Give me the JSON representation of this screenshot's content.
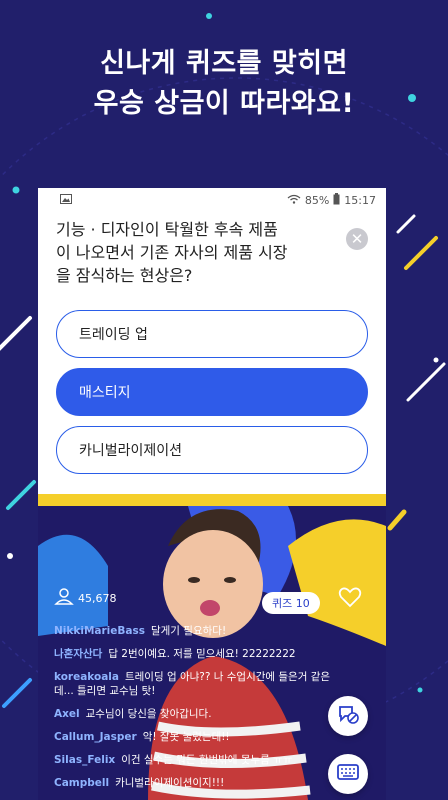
{
  "promo": {
    "line1": "신나게 퀴즈를 맞히면",
    "line2": "우승 상금이 따라와요!"
  },
  "statusbar": {
    "battery": "85%",
    "time": "15:17"
  },
  "quiz": {
    "question": "기능 · 디자인이 탁월한 후속 제품\n이 나오면서 기존 자사의 제품 시장\n을 잠식하는 현상은?",
    "options": [
      {
        "label": "트레이딩 업",
        "selected": false
      },
      {
        "label": "매스티지",
        "selected": true
      },
      {
        "label": "카니벌라이제이션",
        "selected": false
      }
    ]
  },
  "live": {
    "viewer_count": "45,678",
    "quiz_badge": "퀴즈 10",
    "chat": [
      {
        "user": "NikkiMarieBass",
        "text": "달게기 필요하다!"
      },
      {
        "user": "나혼자산다",
        "text": "답 2번이예요. 저를 믿으세요! 22222222"
      },
      {
        "user": "koreakoala",
        "text": "트레이딩 업 아냐?? 나 수업시간에 들은거 같은데... 틀리면 교수님 탓!"
      },
      {
        "user": "Axel",
        "text": "교수님이 당신을 찾아갑니다."
      },
      {
        "user": "Callum_Jasper",
        "text": "악! 잘못 눌렀는데!!"
      },
      {
        "user": "Silas_Felix",
        "text": "이건 실수는 뭐든 한번밖에 못누름 ㅠㅠ"
      },
      {
        "user": "Campbell",
        "text": "카니벌라이제이션이지!!!"
      }
    ]
  },
  "colors": {
    "background": "#211f6b",
    "accent_blue": "#2f5be9",
    "accent_yellow": "#f5cf2a",
    "decor_cyan": "#3fd3e0"
  }
}
